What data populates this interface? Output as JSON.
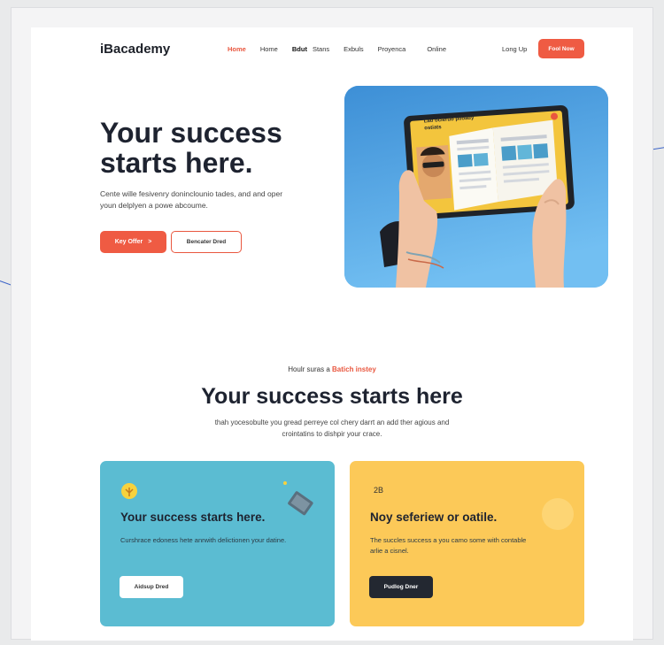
{
  "header": {
    "logo": "iBacademy",
    "nav": [
      "Home",
      "Home",
      "Bdut",
      "Stans",
      "Exbuls",
      "Proyenca",
      "Online"
    ],
    "signin": "Long Up",
    "cta": "Fool Now"
  },
  "hero": {
    "title": "Your success starts here.",
    "subtitle": "Cente wille fesivenry doninclounio tades, and and oper youn delplyen a powe abcoume.",
    "primary_button": "Key Offer",
    "primary_arrow": ">",
    "secondary_button": "Bencater Dred",
    "tablet_heading": "Lao ocieruo plioady ostiats"
  },
  "section": {
    "eyebrow_prefix": "Houlr suras a",
    "eyebrow_highlight": "Batich instey",
    "title": "Your success starts here",
    "subtitle": "thah yocesobulte you gread perreye col chery darrt an add ther agious and crointatins to dishpir your crace."
  },
  "cards": [
    {
      "title": "Your success starts here.",
      "text": "Curshrace edoness hete anrwith delictionen your datine.",
      "button": "Aidsup Dred"
    },
    {
      "number": "2B",
      "title": "Noy seferiew or oatile.",
      "text": "The succles success a you camo some with contable arlie a cisnel.",
      "button": "Pudlog Dner"
    }
  ],
  "colors": {
    "accent": "#ef5b43",
    "card_blue": "#5bbcd2",
    "card_yellow": "#fcc958",
    "dark": "#232831"
  }
}
